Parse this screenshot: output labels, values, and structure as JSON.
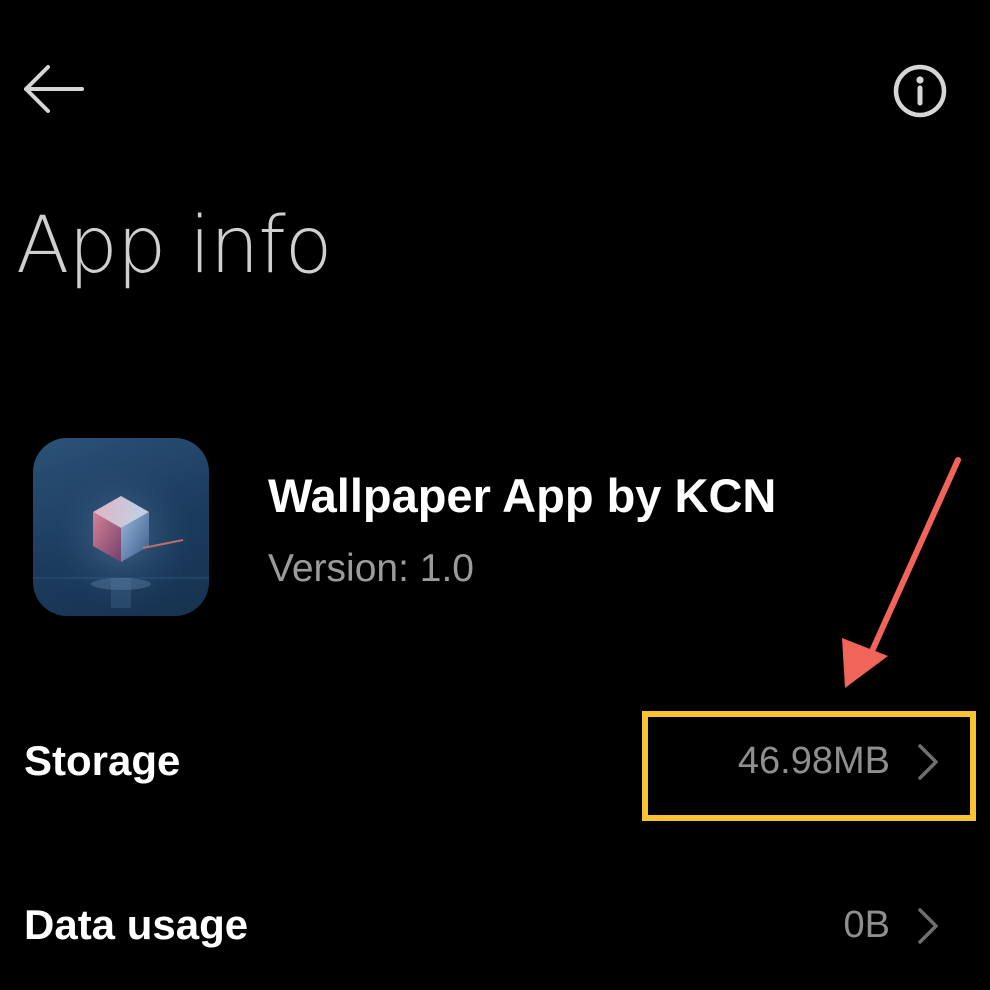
{
  "header": {
    "back_icon": "arrow-left-icon",
    "info_icon": "info-circle-icon",
    "title": "App info"
  },
  "app": {
    "icon": "app-icon-crystal-cube",
    "name": "Wallpaper App by KCN",
    "version": "Version: 1.0"
  },
  "rows": [
    {
      "label": "Storage",
      "value": "46.98MB",
      "chevron_icon": "chevron-right-icon"
    },
    {
      "label": "Data usage",
      "value": "0B",
      "chevron_icon": "chevron-right-icon"
    }
  ],
  "annotation": {
    "highlight_color": "#f7c430",
    "arrow_color": "#f0645a"
  },
  "theme": {
    "background": "#000000",
    "title_color": "#cfcfcf",
    "secondary_text": "#9b9b9b"
  }
}
